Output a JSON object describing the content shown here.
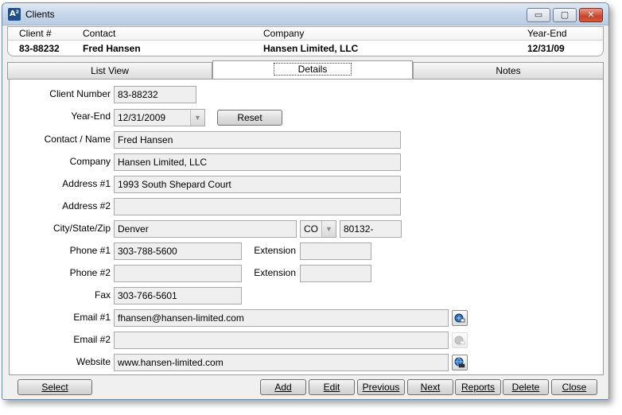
{
  "window": {
    "title": "Clients",
    "app_icon": "A²",
    "min_glyph": "▭",
    "max_glyph": "▢",
    "close_glyph": "✕"
  },
  "header": {
    "columns": [
      "Client #",
      "Contact",
      "Company",
      "Year-End"
    ],
    "values": [
      "83-88232",
      "Fred Hansen",
      "Hansen Limited, LLC",
      "12/31/09"
    ]
  },
  "tabs": [
    "List View",
    "Details",
    "Notes"
  ],
  "form": {
    "client_number": {
      "label": "Client Number",
      "value": "83-88232"
    },
    "year_end": {
      "label": "Year-End",
      "value": "12/31/2009"
    },
    "reset_label": "Reset",
    "contact": {
      "label": "Contact / Name",
      "value": "Fred Hansen"
    },
    "company": {
      "label": "Company",
      "value": "Hansen Limited, LLC"
    },
    "address1": {
      "label": "Address #1",
      "value": "1993 South Shepard Court"
    },
    "address2": {
      "label": "Address #2",
      "value": ""
    },
    "city_state_zip": {
      "label": "City/State/Zip",
      "city": "Denver",
      "state": "CO",
      "zip": "80132-"
    },
    "phone1": {
      "label": "Phone #1",
      "value": "303-788-5600",
      "ext_label": "Extension",
      "ext_value": ""
    },
    "phone2": {
      "label": "Phone #2",
      "value": "",
      "ext_label": "Extension",
      "ext_value": ""
    },
    "fax": {
      "label": "Fax",
      "value": "303-766-5601"
    },
    "email1": {
      "label": "Email #1",
      "value": "fhansen@hansen-limited.com"
    },
    "email2": {
      "label": "Email #2",
      "value": ""
    },
    "website": {
      "label": "Website",
      "value": "www.hansen-limited.com"
    }
  },
  "buttons": {
    "select": "Select",
    "add": "Add",
    "edit": "Edit",
    "previous": "Previous",
    "next": "Next",
    "reports": "Reports",
    "delete": "Delete",
    "close": "Close"
  },
  "icons": {
    "email1": "send-email-icon",
    "email2": "send-email-icon",
    "website": "open-website-icon"
  }
}
